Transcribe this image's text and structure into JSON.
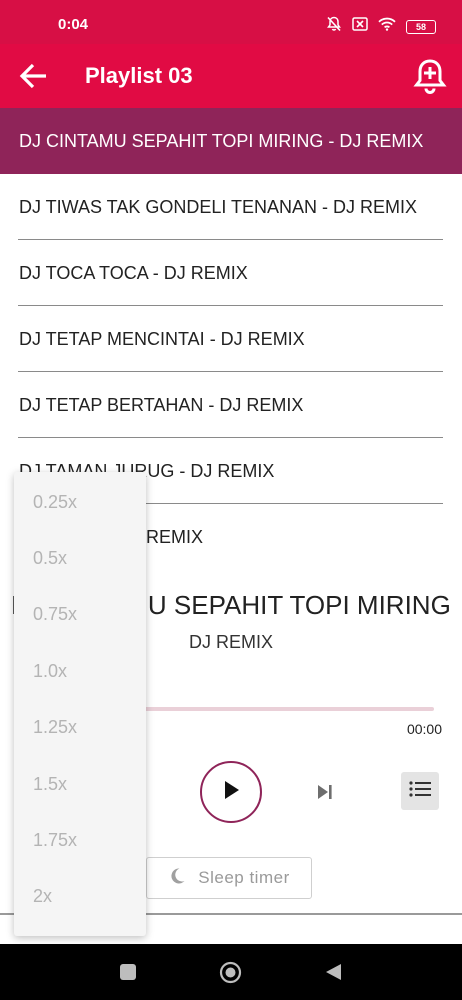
{
  "status_bar": {
    "time": "0:04",
    "battery": "58",
    "icons": [
      "bell-off-icon",
      "sim-x-icon",
      "wifi-icon",
      "battery-icon"
    ]
  },
  "toolbar": {
    "title": "Playlist 03",
    "back_icon": "arrow-left-icon",
    "action_icon": "add-alarm-icon"
  },
  "tracks": [
    {
      "title": "DJ CINTAMU SEPAHIT TOPI MIRING - DJ REMIX",
      "active": true
    },
    {
      "title": "DJ TIWAS TAK GONDELI TENANAN - DJ REMIX",
      "active": false
    },
    {
      "title": "DJ TOCA TOCA - DJ REMIX",
      "active": false
    },
    {
      "title": "DJ TETAP MENCINTAI - DJ REMIX",
      "active": false
    },
    {
      "title": "DJ TETAP BERTAHAN - DJ REMIX",
      "active": false
    },
    {
      "title": "DJ TAMAN JURUG - DJ REMIX",
      "active": false
    },
    {
      "title": "DJ RINDU - DJ REMIX",
      "active": false
    }
  ],
  "player": {
    "title": "DJ CINTAMU SEPAHIT TOPI MIRING",
    "artist": "DJ REMIX",
    "duration": "00:00",
    "progress": 0,
    "sleep_timer_label": "Sleep timer"
  },
  "speed_menu": {
    "options": [
      "0.25x",
      "0.5x",
      "0.75x",
      "1.0x",
      "1.25x",
      "1.5x",
      "1.75x",
      "2x"
    ]
  },
  "colors": {
    "status_bar": "#d70f45",
    "toolbar": "#e10b44",
    "active_row": "#8f2459",
    "accent": "#8f2459"
  }
}
